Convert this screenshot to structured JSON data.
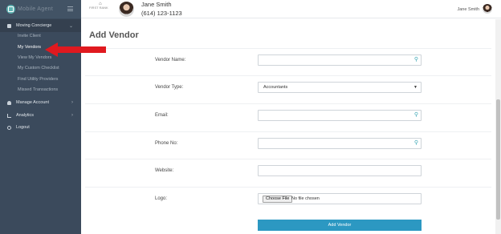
{
  "sidebar": {
    "brand": "Mobile Agent",
    "moving_concierge": "Moving Concierge",
    "children": [
      "Invite Client",
      "My Vendors",
      "View My Vendors",
      "My Custom Checklist",
      "Find Utility Providers",
      "Missed Transactions"
    ],
    "manage_account": "Manage Account",
    "analytics": "Analytics",
    "logout": "Logout"
  },
  "header": {
    "mini_logo": "FIRST RANK",
    "agent_name": "Jane Smith",
    "agent_phone": "(614) 123-1123",
    "user_name": "Jane Smith"
  },
  "form": {
    "title": "Add Vendor",
    "vendor_name_label": "Vendor Name:",
    "vendor_type_label": "Vendor Type:",
    "vendor_type_value": "Accountants",
    "email_label": "Email:",
    "phone_label": "Phone No:",
    "website_label": "Website:",
    "logo_label": "Logo:",
    "choose_file": "Choose File",
    "no_file": "No file chosen",
    "submit": "Add Vendor"
  },
  "icons": {
    "field_key": "key-icon",
    "caret": "caret-down-icon",
    "annotation": "red-arrow-icon"
  },
  "colors": {
    "sidebar_bg": "#3b4a5c",
    "accent": "#2c98c2",
    "annotation": "#e0191f"
  }
}
